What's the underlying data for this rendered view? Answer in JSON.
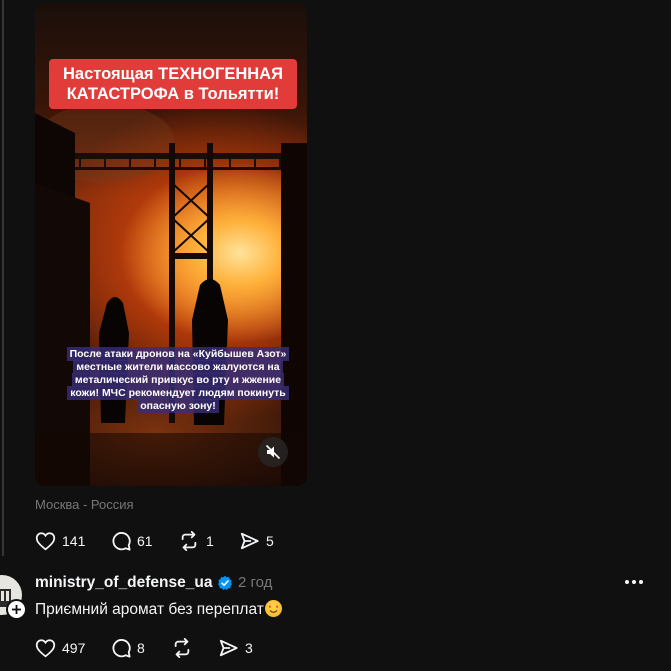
{
  "post": {
    "video": {
      "title_line1": "Настоящая ТЕХНОГЕННАЯ",
      "title_line2": "КАТАСТРОФА в Тольятти!",
      "caption": "После атаки дронов на «Куйбышев Азот» местные жители массово жалуются на металический привкус во рту и жжение кожи! МЧС рекомендует людям покинуть опасную зону!",
      "mute_icon": "volume-muted-icon"
    },
    "location": "Москва - Россия",
    "actions": {
      "likes": "141",
      "replies": "61",
      "reposts": "1",
      "shares": "5"
    }
  },
  "reply": {
    "username": "ministry_of_defense_ua",
    "verified": true,
    "time": "2 год",
    "text": "Приємний аромат без переплат",
    "emoji": "smiling-face-with-heart-eyes",
    "actions": {
      "likes": "497",
      "replies": "8",
      "reposts": "",
      "shares": "3"
    }
  },
  "colors": {
    "background": "#101010",
    "text": "#f3f5f7",
    "muted": "#777777",
    "title_box": "#e23c3a",
    "verified": "#0095f6"
  }
}
